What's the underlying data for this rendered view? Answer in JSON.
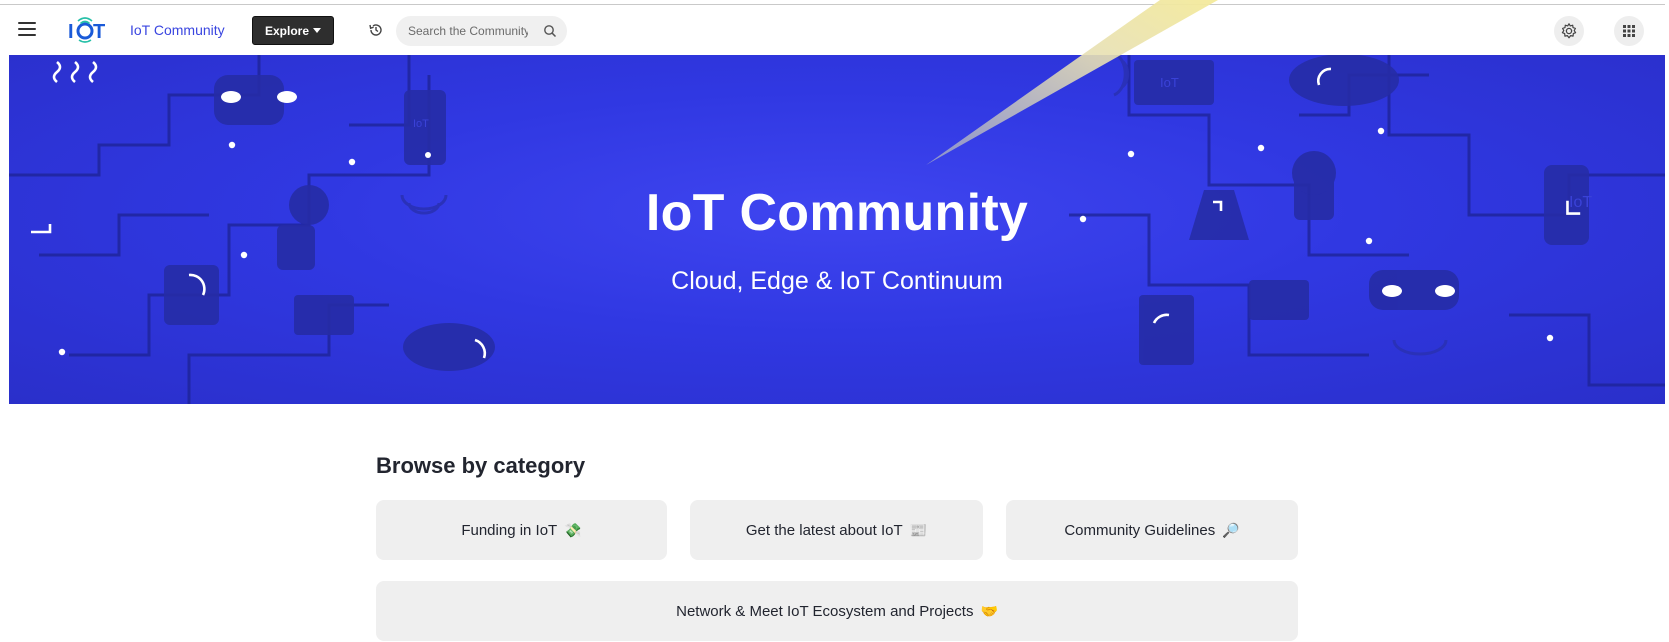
{
  "nav": {
    "brand": "IoT Community",
    "logo_text": "IOT",
    "explore_label": "Explore",
    "search_placeholder": "Search the Community"
  },
  "hero": {
    "title": "IoT Community",
    "subtitle": "Cloud, Edge & IoT Continuum",
    "background_color": "#3038e2"
  },
  "browse": {
    "title": "Browse by category",
    "categories": [
      {
        "label": "Funding in IoT",
        "icon": "💸"
      },
      {
        "label": "Get the latest about IoT",
        "icon": "📰"
      },
      {
        "label": "Community Guidelines",
        "icon": "🔎"
      },
      {
        "label": "Network & Meet IoT Ecosystem and Projects",
        "icon": "🤝"
      }
    ]
  },
  "colors": {
    "accent": "#3a46e0",
    "card_bg": "#efefef",
    "explore_bg": "#2e2e2e"
  }
}
